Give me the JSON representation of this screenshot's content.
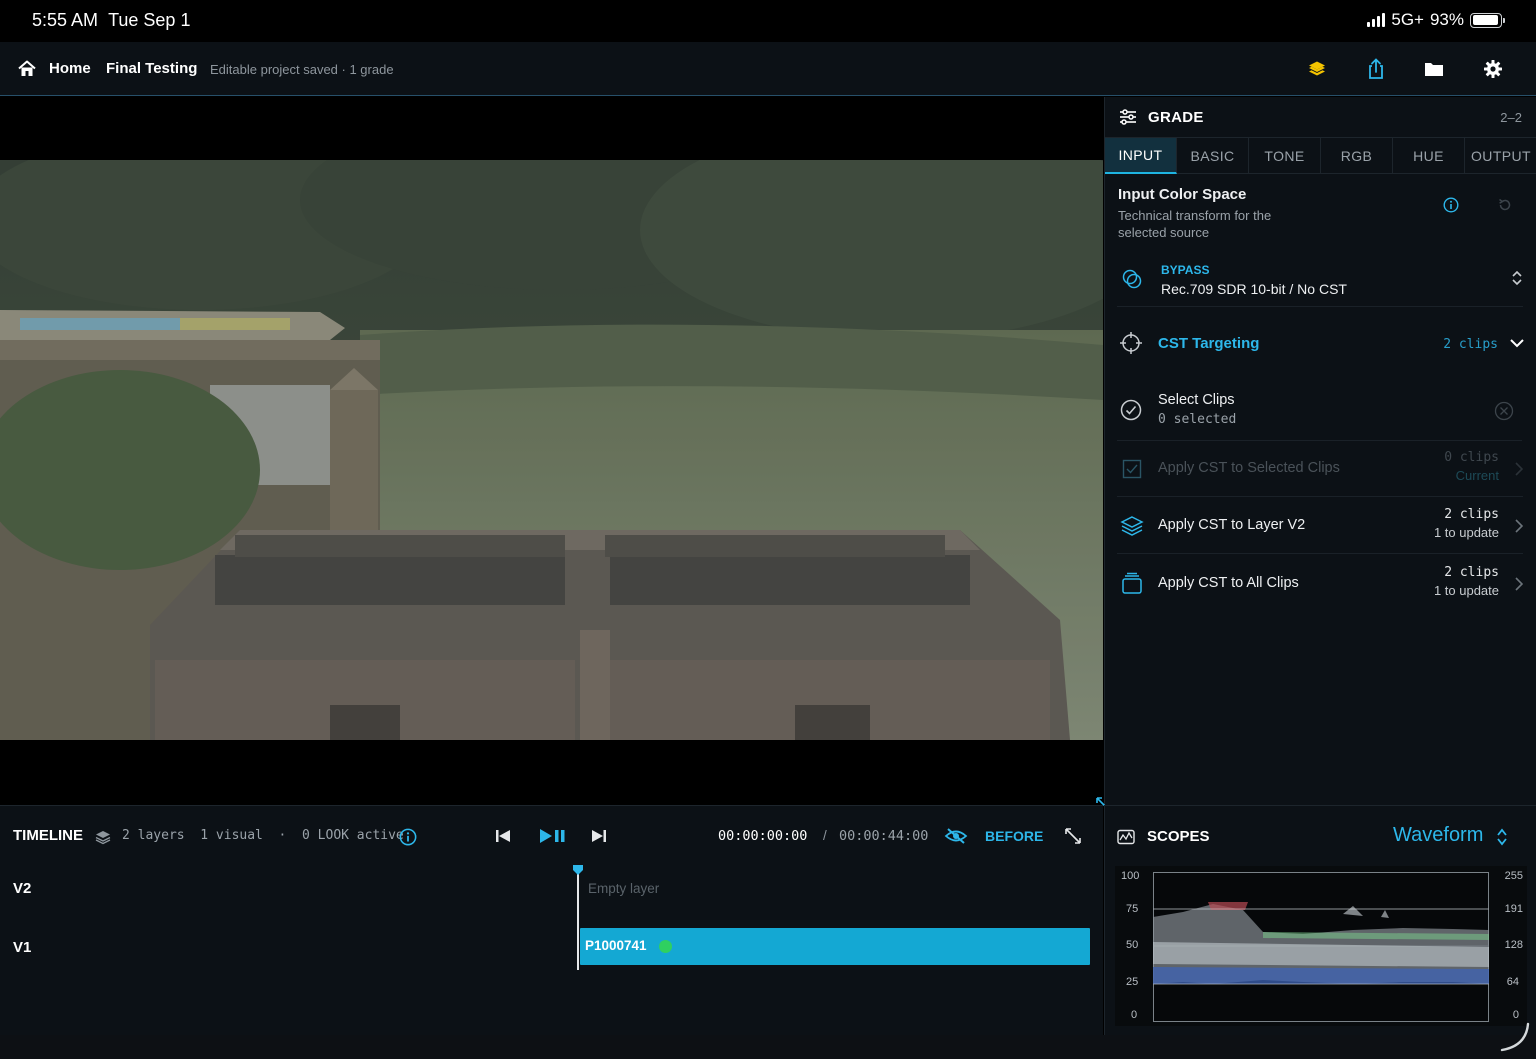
{
  "status_bar": {
    "time": "5:55 AM",
    "date": "Tue Sep 1",
    "network": "5G+",
    "battery": "93%",
    "battery_level": 0.93
  },
  "nav": {
    "home_label": "Home",
    "project_title": "Final Testing",
    "project_status": "Editable project saved · 1 grade",
    "icons": [
      "layers-icon",
      "share-icon",
      "folder-icon",
      "gear-icon"
    ],
    "accent_color": "#f5c400"
  },
  "grade": {
    "title": "GRADE",
    "count": "2–2",
    "tabs": [
      {
        "label": "INPUT",
        "active": true
      },
      {
        "label": "BASIC",
        "active": false
      },
      {
        "label": "TONE",
        "active": false
      },
      {
        "label": "RGB",
        "active": false
      },
      {
        "label": "HUE",
        "active": false
      },
      {
        "label": "OUTPUT",
        "active": false
      }
    ],
    "input_color_space": {
      "title": "Input Color Space",
      "description": "Technical transform for the selected source"
    },
    "bypass": {
      "label": "BYPASS",
      "value": "Rec.709 SDR 10-bit / No CST"
    },
    "cst_targeting": {
      "title": "CST Targeting",
      "count": "2 clips"
    },
    "select_clips": {
      "title": "Select Clips",
      "status": "0 selected"
    },
    "actions": [
      {
        "label": "Apply CST to Selected Clips",
        "clips": "0 clips",
        "detail": "Current",
        "enabled": false
      },
      {
        "label": "Apply CST to Layer V2",
        "clips": "2 clips",
        "detail": "1 to update",
        "enabled": true
      },
      {
        "label": "Apply CST to All Clips",
        "clips": "2 clips",
        "detail": "1 to update",
        "enabled": true
      }
    ],
    "accent_color": "#2db7ea"
  },
  "timeline": {
    "title": "TIMELINE",
    "summary": "2 layers  1 visual  ·  0 LOOK active",
    "current_time": "00:00:00:00",
    "separator": "/",
    "total_time": "00:00:44:00",
    "before_label": "BEFORE",
    "tracks": [
      {
        "name": "V2",
        "empty_text": "Empty layer"
      },
      {
        "name": "V1",
        "clip_name": "P1000741",
        "clip_color": "#14a8d3"
      }
    ]
  },
  "scopes": {
    "title": "SCOPES",
    "mode": "Waveform",
    "left_axis": [
      "100",
      "75",
      "50",
      "25",
      "0"
    ],
    "right_axis": [
      "255",
      "191",
      "128",
      "64",
      "0"
    ]
  }
}
